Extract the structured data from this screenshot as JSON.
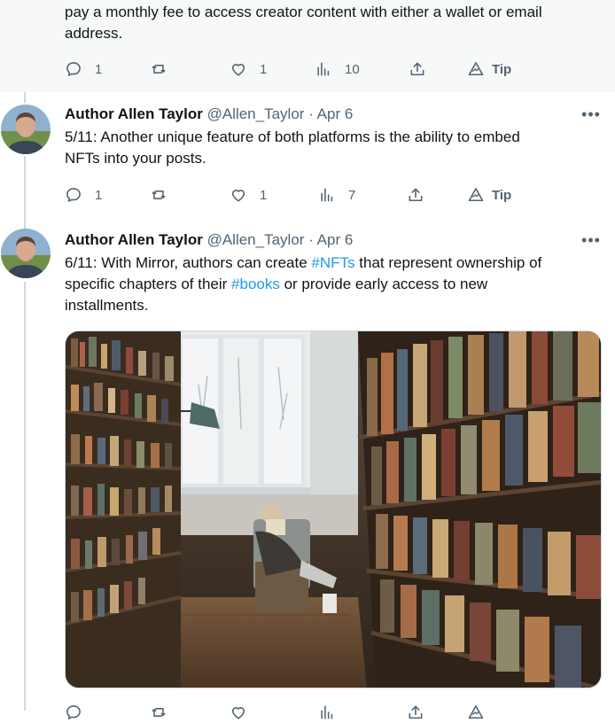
{
  "tweet_top": {
    "text_line1": "pay a monthly fee to access creator content with either a wallet or email",
    "text_line2": "address.",
    "replies": "1",
    "likes": "1",
    "views": "10",
    "tip_label": "Tip"
  },
  "tweet_2": {
    "author": "Author Allen Taylor",
    "handle": "@Allen_Taylor",
    "separator": "·",
    "date": "Apr 6",
    "text_line1": "5/11: Another unique feature of both platforms is the ability to embed",
    "text_line2": "NFTs into your posts.",
    "replies": "1",
    "likes": "1",
    "views": "7",
    "tip_label": "Tip"
  },
  "tweet_3": {
    "author": "Author Allen Taylor",
    "handle": "@Allen_Taylor",
    "separator": "·",
    "date": "Apr 6",
    "text_part1": "6/11: With Mirror, authors can create ",
    "hashtag_nfts": "#NFTs",
    "text_part2": " that represent ownership of",
    "text_part3": "specific chapters of their ",
    "hashtag_books": "#books",
    "text_part4": " or provide early access to new",
    "text_part5": "installments."
  },
  "icons": {
    "reply": "reply-icon",
    "retweet": "retweet-icon",
    "like": "like-icon",
    "views": "views-icon",
    "share": "share-icon",
    "tip": "tip-icon",
    "more": "more-options-icon"
  },
  "colors": {
    "text": "#0f1419",
    "secondary": "#536471",
    "link": "#1d9bf0",
    "thread_line": "#cfd9de",
    "highlight_bg": "#f7f9f9"
  }
}
